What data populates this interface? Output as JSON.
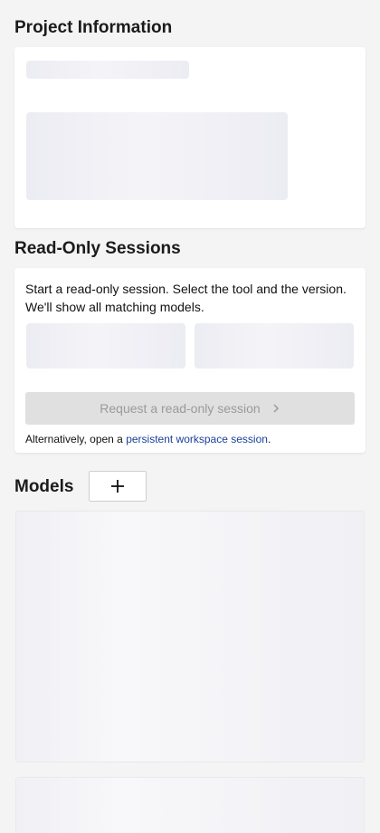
{
  "project_info": {
    "title": "Project Information"
  },
  "read_only_sessions": {
    "title": "Read-Only Sessions",
    "description_line1": "Start a read-only session. Select the tool and the version.",
    "description_line2": "We'll show all matching models.",
    "request_button_label": "Request a read-only session",
    "alt_prefix": "Alternatively, open a ",
    "alt_link_text": "persistent workspace session",
    "alt_suffix": "."
  },
  "models": {
    "title": "Models",
    "add_icon": "plus-icon"
  },
  "colors": {
    "page_background": "#f4f4f4",
    "card_background": "#ffffff",
    "link": "#1a3f9b",
    "disabled_button_bg": "#e0e0e0",
    "disabled_button_text": "#9a9a9a"
  }
}
